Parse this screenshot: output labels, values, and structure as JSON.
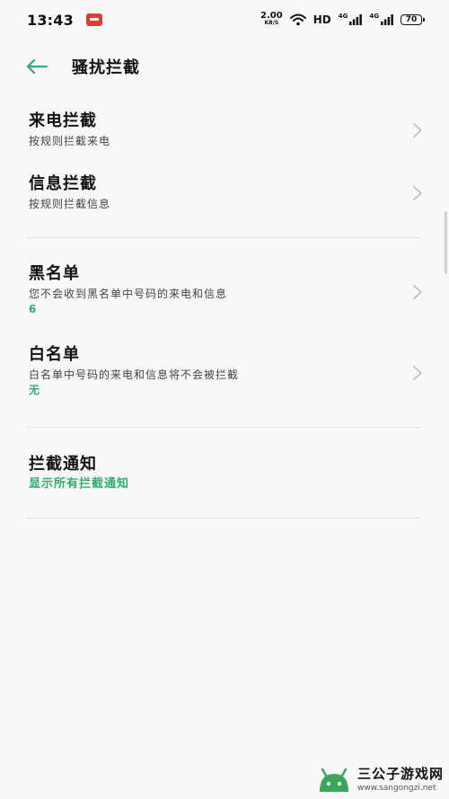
{
  "status_bar": {
    "time": "13:43",
    "speed_value": "2.00",
    "speed_unit": "KB/S",
    "hd": "HD",
    "net1": "4G",
    "net2": "4G",
    "battery": "70"
  },
  "header": {
    "title": "骚扰拦截"
  },
  "items": [
    {
      "title": "来电拦截",
      "subtitle": "按规则拦截来电"
    },
    {
      "title": "信息拦截",
      "subtitle": "按规则拦截信息"
    },
    {
      "title": "黑名单",
      "subtitle": "您不会收到黑名单中号码的来电和信息",
      "value": "6"
    },
    {
      "title": "白名单",
      "subtitle": "白名单中号码的来电和信息将不会被拦截",
      "value": "无"
    },
    {
      "title": "拦截通知",
      "value": "显示所有拦截通知"
    }
  ],
  "watermark": {
    "brand": "三公子游戏网",
    "url": "www.sangongzi.net"
  },
  "colors": {
    "accent": "#2fae72",
    "background": "#f8f8f8",
    "divider": "#e2e2e2"
  }
}
